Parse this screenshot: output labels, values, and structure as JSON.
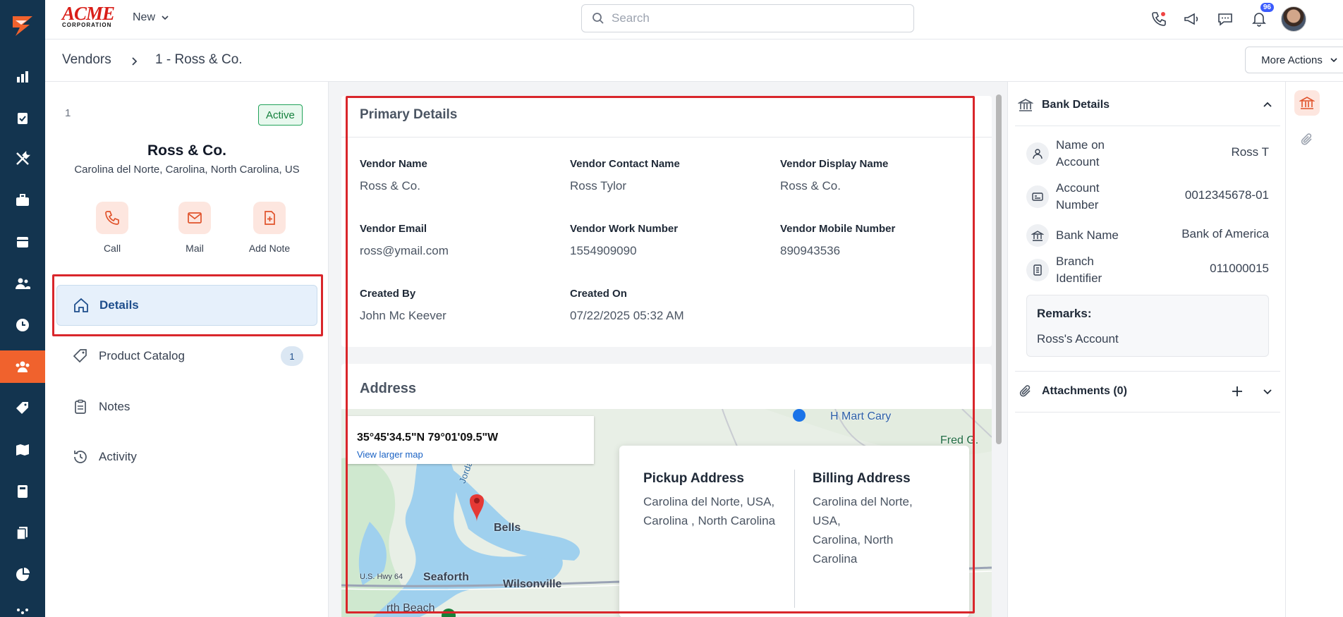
{
  "brand": {
    "name": "ACME",
    "sub": "CORPORATION"
  },
  "topbar": {
    "new_label": "New",
    "search_placeholder": "Search",
    "notifications_count": "96"
  },
  "breadcrumb": {
    "root": "Vendors",
    "current": "1 - Ross & Co."
  },
  "more_actions_label": "More Actions",
  "profile": {
    "id": "1",
    "status": "Active",
    "name": "Ross & Co.",
    "location": "Carolina del Norte, Carolina, North Carolina, US",
    "actions": [
      {
        "label": "Call",
        "icon": "phone-icon"
      },
      {
        "label": "Mail",
        "icon": "mail-icon"
      },
      {
        "label": "Add Note",
        "icon": "add-note-icon"
      }
    ],
    "menu": [
      {
        "label": "Details",
        "icon": "home-icon",
        "active": true
      },
      {
        "label": "Product Catalog",
        "icon": "tag-icon",
        "count": "1"
      },
      {
        "label": "Notes",
        "icon": "clipboard-icon"
      },
      {
        "label": "Activity",
        "icon": "history-icon"
      }
    ]
  },
  "primary_details": {
    "title": "Primary Details",
    "fields": [
      {
        "label": "Vendor Name",
        "value": "Ross & Co."
      },
      {
        "label": "Vendor Contact Name",
        "value": "Ross Tylor"
      },
      {
        "label": "Vendor Display Name",
        "value": "Ross & Co."
      },
      {
        "label": "Vendor Email",
        "value": "ross@ymail.com"
      },
      {
        "label": "Vendor Work Number",
        "value": "1554909090"
      },
      {
        "label": "Vendor Mobile Number",
        "value": "890943536"
      },
      {
        "label": "Created By",
        "value": "John Mc Keever"
      },
      {
        "label": "Created On",
        "value": "07/22/2025 05:32 AM"
      }
    ]
  },
  "address": {
    "title": "Address",
    "coordinates": "35°45'34.5\"N 79°01'09.5\"W",
    "view_larger_map": "View larger map",
    "map_labels": {
      "hmart": "H Mart Cary",
      "bells": "Bells",
      "seaforth": "Seaforth",
      "wilsonville": "Wilsonville",
      "fred": "Fred G. Bo",
      "beach": "rth Beach",
      "hwy": "U.S. Hwy 64",
      "jordan": "Jorda"
    },
    "pickup": {
      "title": "Pickup Address",
      "line1": "Carolina del Norte, USA,",
      "line2": "Carolina , North Carolina"
    },
    "billing": {
      "title": "Billing Address",
      "line1": "Carolina del Norte,",
      "line2": "USA,",
      "line3": "Carolina, North",
      "line4": "Carolina"
    }
  },
  "bank_details": {
    "title": "Bank Details",
    "rows": [
      {
        "label": "Name on Account",
        "value": "Ross T",
        "icon": "user-icon"
      },
      {
        "label": "Account Number",
        "value": "0012345678-01",
        "icon": "id-card-icon"
      },
      {
        "label": "Bank Name",
        "value": "Bank of America",
        "icon": "bank-icon"
      },
      {
        "label": "Branch Identifier",
        "value": "011000015",
        "icon": "branch-icon"
      }
    ],
    "remarks_label": "Remarks:",
    "remarks_value": "Ross's Account"
  },
  "attachments_label": "Attachments (0)",
  "colors": {
    "accent": "#f0622d",
    "rail": "#13344f",
    "highlight": "#d9262b",
    "active_bg": "#e6f0fb"
  }
}
